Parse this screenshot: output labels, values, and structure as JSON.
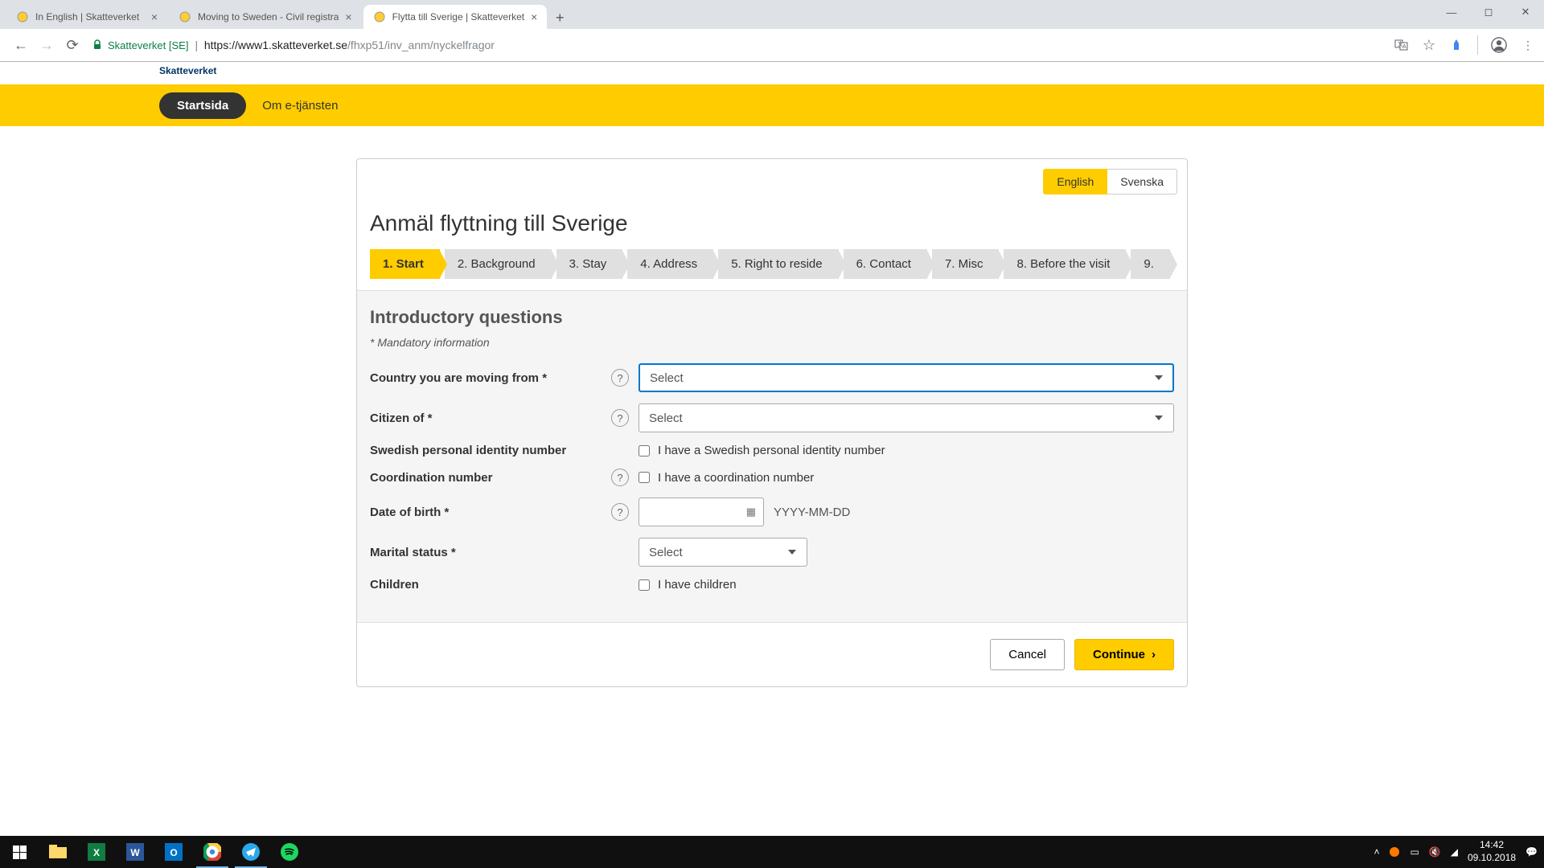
{
  "browser": {
    "tabs": [
      {
        "title": "In English | Skatteverket"
      },
      {
        "title": "Moving to Sweden - Civil registra"
      },
      {
        "title": "Flytta till Sverige | Skatteverket",
        "active": true
      }
    ],
    "secure_label": "Skatteverket [SE]",
    "url_host": "https://www1.skatteverket.se",
    "url_path": "/fhxp51/inv_anm/nyckelfragor"
  },
  "header": {
    "logo_text": "Skatteverket",
    "nav_active": "Startsida",
    "nav_link": "Om e-tjänsten"
  },
  "lang": {
    "english": "English",
    "svenska": "Svenska"
  },
  "page_title": "Anmäl flyttning till Sverige",
  "steps": [
    "1. Start",
    "2. Background",
    "3. Stay",
    "4. Address",
    "5. Right to reside",
    "6. Contact",
    "7. Misc",
    "8. Before the visit",
    "9."
  ],
  "form": {
    "section_title": "Introductory questions",
    "mandatory_note": "* Mandatory information",
    "country_label": "Country you are moving from *",
    "citizen_label": "Citizen of *",
    "select_placeholder": "Select",
    "pin_label": "Swedish personal identity number",
    "pin_check": "I have a Swedish personal identity number",
    "coord_label": "Coordination number",
    "coord_check": "I have a coordination number",
    "dob_label": "Date of birth *",
    "dob_hint": "YYYY-MM-DD",
    "marital_label": "Marital status *",
    "children_label": "Children",
    "children_check": "I have children"
  },
  "buttons": {
    "cancel": "Cancel",
    "continue": "Continue"
  },
  "taskbar": {
    "time": "14:42",
    "date": "09.10.2018"
  }
}
